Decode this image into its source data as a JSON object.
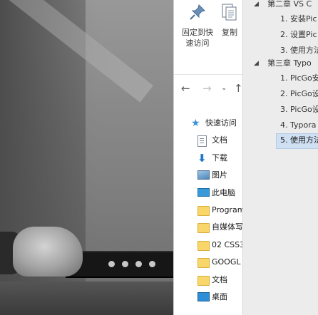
{
  "ribbon": {
    "pin_label_line1": "固定到快",
    "pin_label_line2": "速访问",
    "copy_label": "复制"
  },
  "nav_buttons": {
    "back": "←",
    "forward": "→",
    "recent": "⌄",
    "up": "↑"
  },
  "navigation_pane": [
    {
      "label": "快速访问",
      "icon": "star-icon",
      "level": 0
    },
    {
      "label": "文档",
      "icon": "document-icon",
      "level": 1
    },
    {
      "label": "下载",
      "icon": "download-icon",
      "level": 1
    },
    {
      "label": "图片",
      "icon": "pictures-icon",
      "level": 1
    },
    {
      "label": "此电脑",
      "icon": "computer-icon",
      "level": 1
    },
    {
      "label": "Program",
      "icon": "folder-icon",
      "level": 1
    },
    {
      "label": "自媒体写",
      "icon": "folder-icon",
      "level": 1
    },
    {
      "label": "02 CSS3",
      "icon": "folder-icon",
      "level": 1
    },
    {
      "label": "GOOGL",
      "icon": "folder-icon",
      "level": 1
    },
    {
      "label": "文档",
      "icon": "folder-icon",
      "level": 1
    },
    {
      "label": "桌面",
      "icon": "desktop-icon",
      "level": 1
    }
  ],
  "outline": [
    {
      "text": "第二章  VS C",
      "level": 2,
      "expanded": true
    },
    {
      "text": "1. 安装Pic",
      "level": 3
    },
    {
      "text": "2. 设置Pic",
      "level": 3
    },
    {
      "text": "3. 使用方法",
      "level": 3
    },
    {
      "text": "第三章  Typo",
      "level": 2,
      "expanded": true
    },
    {
      "text": "1. PicGo安",
      "level": 3
    },
    {
      "text": "2. PicGo设",
      "level": 3
    },
    {
      "text": "3. PicGo设",
      "level": 3
    },
    {
      "text": "4. Typora",
      "level": 3
    },
    {
      "text": "5. 使用方法",
      "level": 3,
      "selected": true
    }
  ],
  "colors": {
    "outline_selected_bg": "#cfe0f3",
    "outline_panel_bg": "#ececec",
    "quick_access_star": "#3b8fd4"
  }
}
